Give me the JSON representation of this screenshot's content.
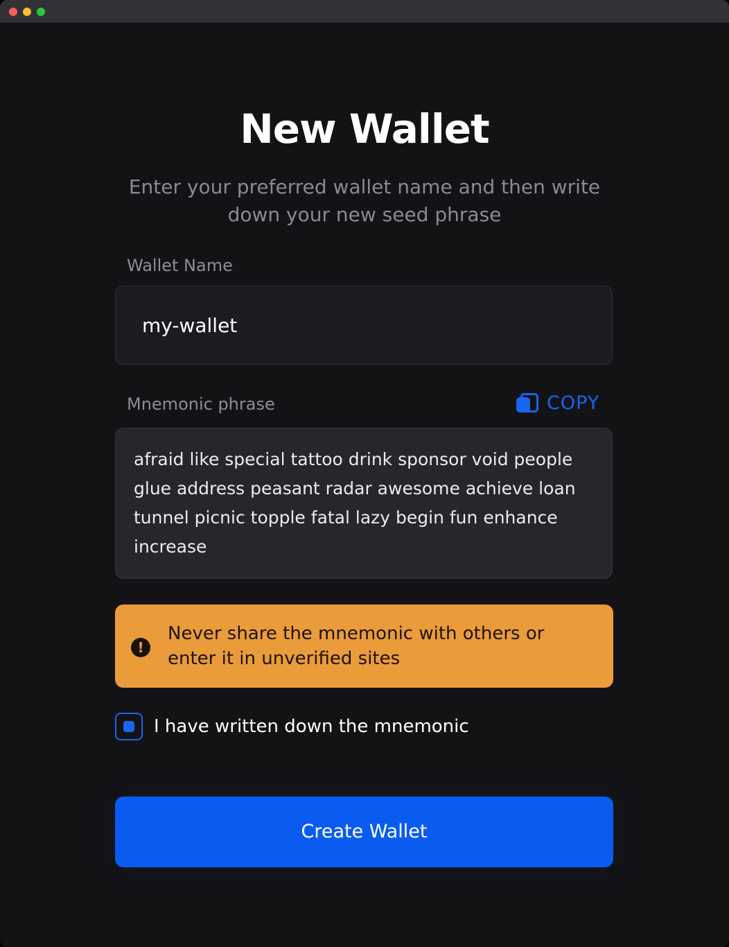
{
  "window": {
    "controls": [
      "close",
      "minimize",
      "zoom"
    ]
  },
  "page": {
    "title": "New Wallet",
    "subtitle": "Enter your preferred wallet name and then write down your new seed phrase"
  },
  "wallet_name": {
    "label": "Wallet Name",
    "value": "my-wallet"
  },
  "mnemonic": {
    "label": "Mnemonic phrase",
    "copy_label": "COPY",
    "copy_icon": "copy-icon",
    "phrase": "afraid like special tattoo drink sponsor void people glue address peasant radar awesome achieve loan tunnel picnic topple fatal lazy begin fun enhance increase"
  },
  "warning": {
    "icon": "exclamation-circle-icon",
    "text": "Never share the mnemonic with others or enter it in unverified sites",
    "color": "#ea9b3a"
  },
  "confirm": {
    "label": "I have written down the mnemonic",
    "checked": true
  },
  "actions": {
    "create_label": "Create Wallet",
    "accent_color": "#0a5cf0"
  }
}
